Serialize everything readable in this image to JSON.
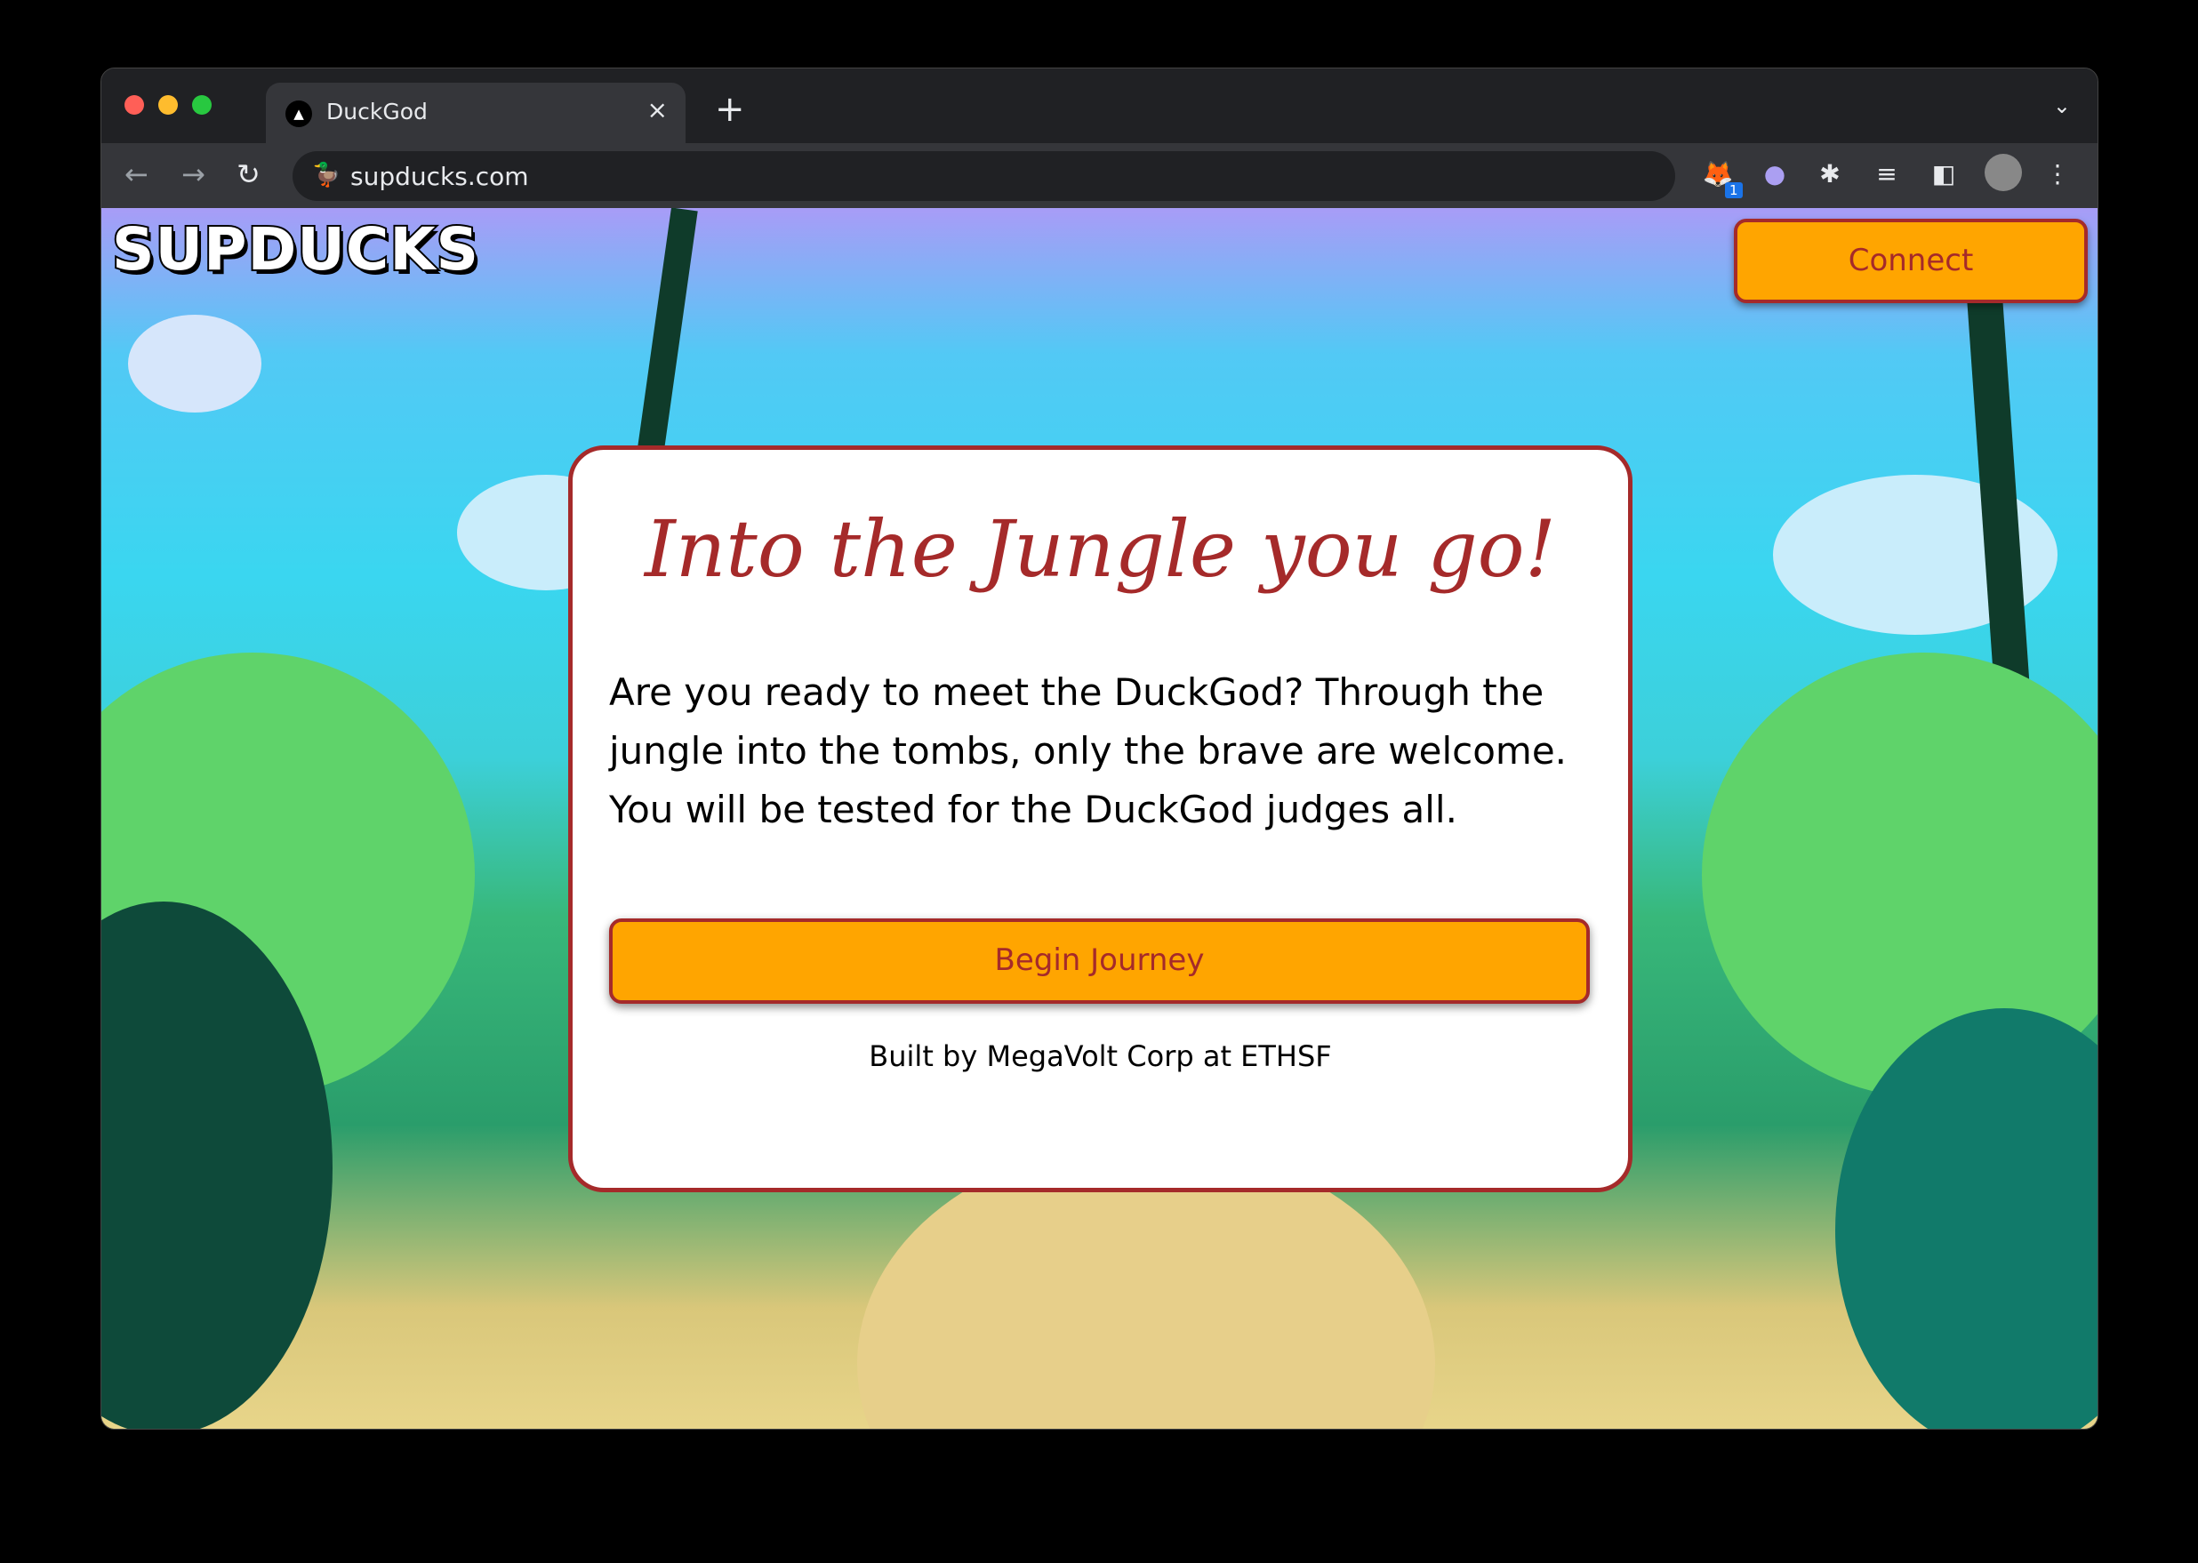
{
  "browser": {
    "tab_title": "DuckGod",
    "tab_close": "×",
    "new_tab": "+",
    "tab_menu": "⌄",
    "url": "supducks.com",
    "extension_badge": "1",
    "icons": [
      "back-icon",
      "forward-icon",
      "reload-icon",
      "site-favicon",
      "metamask-icon",
      "phantom-icon",
      "extensions-puzzle-icon",
      "media-queue-icon",
      "side-panel-icon",
      "profile-avatar",
      "kebab-menu-icon"
    ]
  },
  "header": {
    "logo": "SUPDUCKS",
    "connect_label": "Connect"
  },
  "card": {
    "title": "Into the Jungle you go!",
    "body": "Are you ready to meet the DuckGod? Through the jungle into the tombs, only the brave are welcome. You will be tested for the DuckGod judges all.",
    "button_label": "Begin Journey",
    "footer": "Built by MegaVolt Corp at ETHSF"
  },
  "colors": {
    "accent": "#ffa500",
    "border": "#a52a2a",
    "title": "#a52a2a"
  }
}
